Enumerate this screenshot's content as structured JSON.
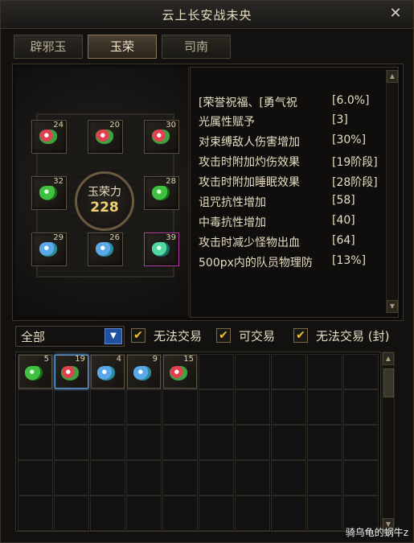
{
  "window": {
    "title": "云上长安战未央",
    "close_label": "✕"
  },
  "tabs": [
    {
      "label": "辟邪玉",
      "active": false
    },
    {
      "label": "玉荣",
      "active": true
    },
    {
      "label": "司南",
      "active": false
    }
  ],
  "gem_slots": [
    {
      "count": "24",
      "gem": "red"
    },
    {
      "count": "20",
      "gem": "red"
    },
    {
      "count": "30",
      "gem": "red"
    },
    {
      "count": "32",
      "gem": "green"
    },
    {
      "count": "28",
      "gem": "green"
    },
    {
      "count": "29",
      "gem": "blue"
    },
    {
      "count": "26",
      "gem": "blue"
    },
    {
      "count": "39",
      "gem": "teal"
    }
  ],
  "center": {
    "label": "玉荣力",
    "value": "228"
  },
  "stats": [
    {
      "name": "[荣誉祝福、[勇气祝",
      "value": "[6.0%]"
    },
    {
      "name": "光属性赋予",
      "value": "[3]"
    },
    {
      "name": "对束缚敌人伤害增加",
      "value": "[30%]"
    },
    {
      "name": "攻击时附加灼伤效果",
      "value": "[19阶段]"
    },
    {
      "name": "攻击时附加睡眠效果",
      "value": "[28阶段]"
    },
    {
      "name": "诅咒抗性增加",
      "value": "[58]"
    },
    {
      "name": "中毒抗性增加",
      "value": "[40]"
    },
    {
      "name": "攻击时减少怪物出血",
      "value": "[64]"
    },
    {
      "name": "500px内的队员物理防",
      "value": "[13%]"
    }
  ],
  "filter": {
    "dropdown_value": "全部",
    "options": [
      {
        "label": "无法交易",
        "checked": true
      },
      {
        "label": "可交易",
        "checked": true
      },
      {
        "label": "无法交易 (封)",
        "checked": true
      }
    ]
  },
  "inventory": [
    {
      "count": "5",
      "gem": "green"
    },
    {
      "count": "19",
      "gem": "red",
      "selected": true
    },
    {
      "count": "4",
      "gem": "blue"
    },
    {
      "count": "9",
      "gem": "blue"
    },
    {
      "count": "15",
      "gem": "red"
    }
  ],
  "watermark": "骑乌龟的蜗牛z"
}
